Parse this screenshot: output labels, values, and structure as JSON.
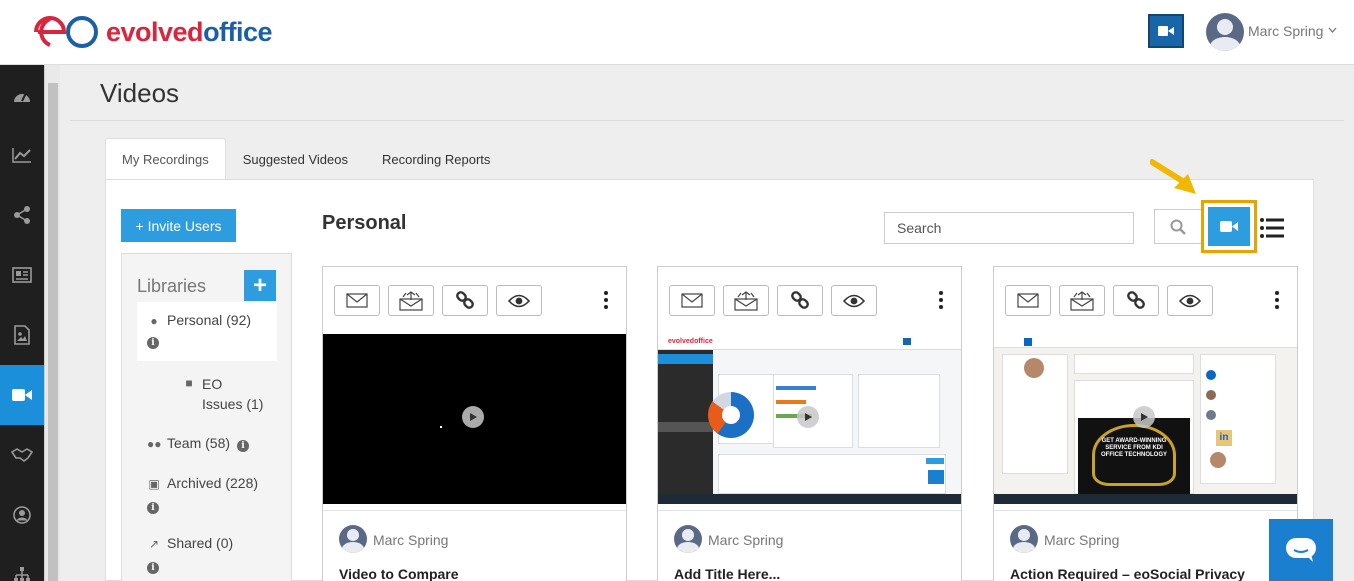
{
  "header": {
    "logo_part1": "evolved",
    "logo_part2": "office",
    "user_name": "Marc Spring"
  },
  "page": {
    "title": "Videos"
  },
  "tabs": [
    {
      "label": "My Recordings",
      "active": true
    },
    {
      "label": "Suggested Videos",
      "active": false
    },
    {
      "label": "Recording Reports",
      "active": false
    }
  ],
  "invite_label": "+ Invite Users",
  "libraries": {
    "title": "Libraries",
    "add_label": "+",
    "items": [
      {
        "label": "Personal (92)",
        "icon": "user-icon"
      },
      {
        "label": "EO Issues (1)",
        "icon": "folder-icon",
        "sub": true
      },
      {
        "label": "Team (58)",
        "icon": "users-icon"
      },
      {
        "label": "Archived (228)",
        "icon": "archive-icon"
      },
      {
        "label": "Shared (0)",
        "icon": "share-icon"
      }
    ]
  },
  "main": {
    "section_title": "Personal",
    "search_placeholder": "Search"
  },
  "cards": [
    {
      "author": "Marc Spring",
      "title": "Video to Compare",
      "thumb": "black"
    },
    {
      "author": "Marc Spring",
      "title": "Add Title Here...",
      "thumb": "dashboard"
    },
    {
      "author": "Marc Spring",
      "title": "Action Required – eoSocial Privacy",
      "thumb": "linkedin"
    }
  ],
  "thumb_text": {
    "dash_logo": "evolvedoffice",
    "award": "GET AWARD-WINNING SERVICE FROM KDI OFFICE TECHNOLOGY",
    "li": "in"
  },
  "colors": {
    "accent": "#2d9de0",
    "nav_bg": "#1f1f1f",
    "highlight": "#e8a300"
  }
}
